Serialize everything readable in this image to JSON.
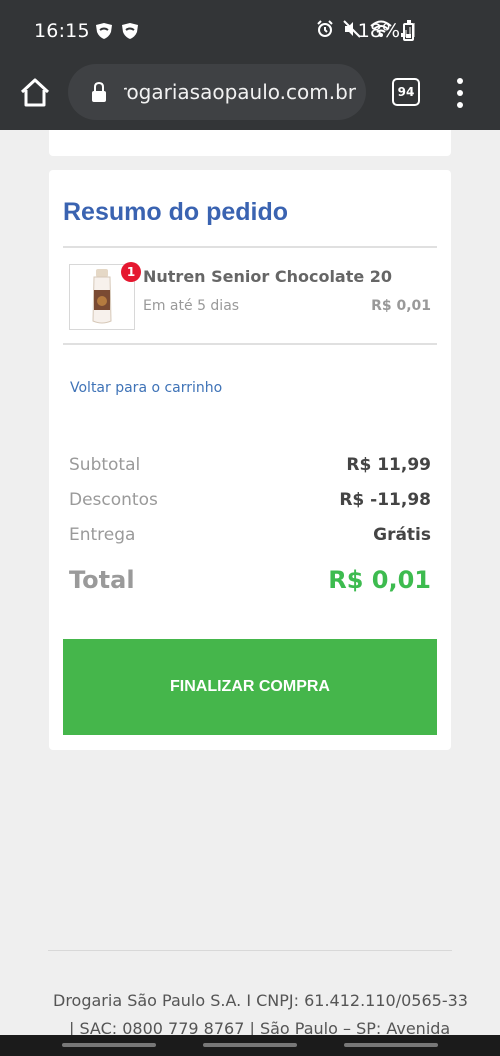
{
  "status_bar": {
    "time": "16:15",
    "battery": "18%"
  },
  "browser": {
    "url": "drogariasaopaulo.com.br",
    "tab_count": "94"
  },
  "summary": {
    "title": "Resumo do pedido",
    "product": {
      "quantity_badge": "1",
      "name": "Nutren Senior Chocolate 20...",
      "delivery": "Em até 5 dias",
      "price": "R$ 0,01"
    },
    "back_link": "Voltar para o carrinho",
    "rows": [
      {
        "label": "Subtotal",
        "value": "R$ 11,99"
      },
      {
        "label": "Descontos",
        "value": "R$ -11,98"
      },
      {
        "label": "Entrega",
        "value": "Grátis"
      }
    ],
    "total_label": "Total",
    "total_value": "R$ 0,01",
    "finalize_button": "FINALIZAR COMPRA"
  },
  "footer": {
    "line1": "Drogaria São Paulo S.A. I CNPJ: 61.412.110/0565-33",
    "line2": "| SAC: 0800 779 8767 | São Paulo – SP: Avenida"
  },
  "colors": {
    "title_blue": "#3a63b1",
    "total_green": "#3dbb4f",
    "button_green": "#45b64b",
    "badge_red": "#e5172f"
  },
  "icons": [
    "home-icon",
    "lock-icon",
    "tabs-icon",
    "more-vert-icon",
    "alarm-icon",
    "mute-icon",
    "wifi-icon",
    "signal-icon",
    "battery-icon"
  ]
}
